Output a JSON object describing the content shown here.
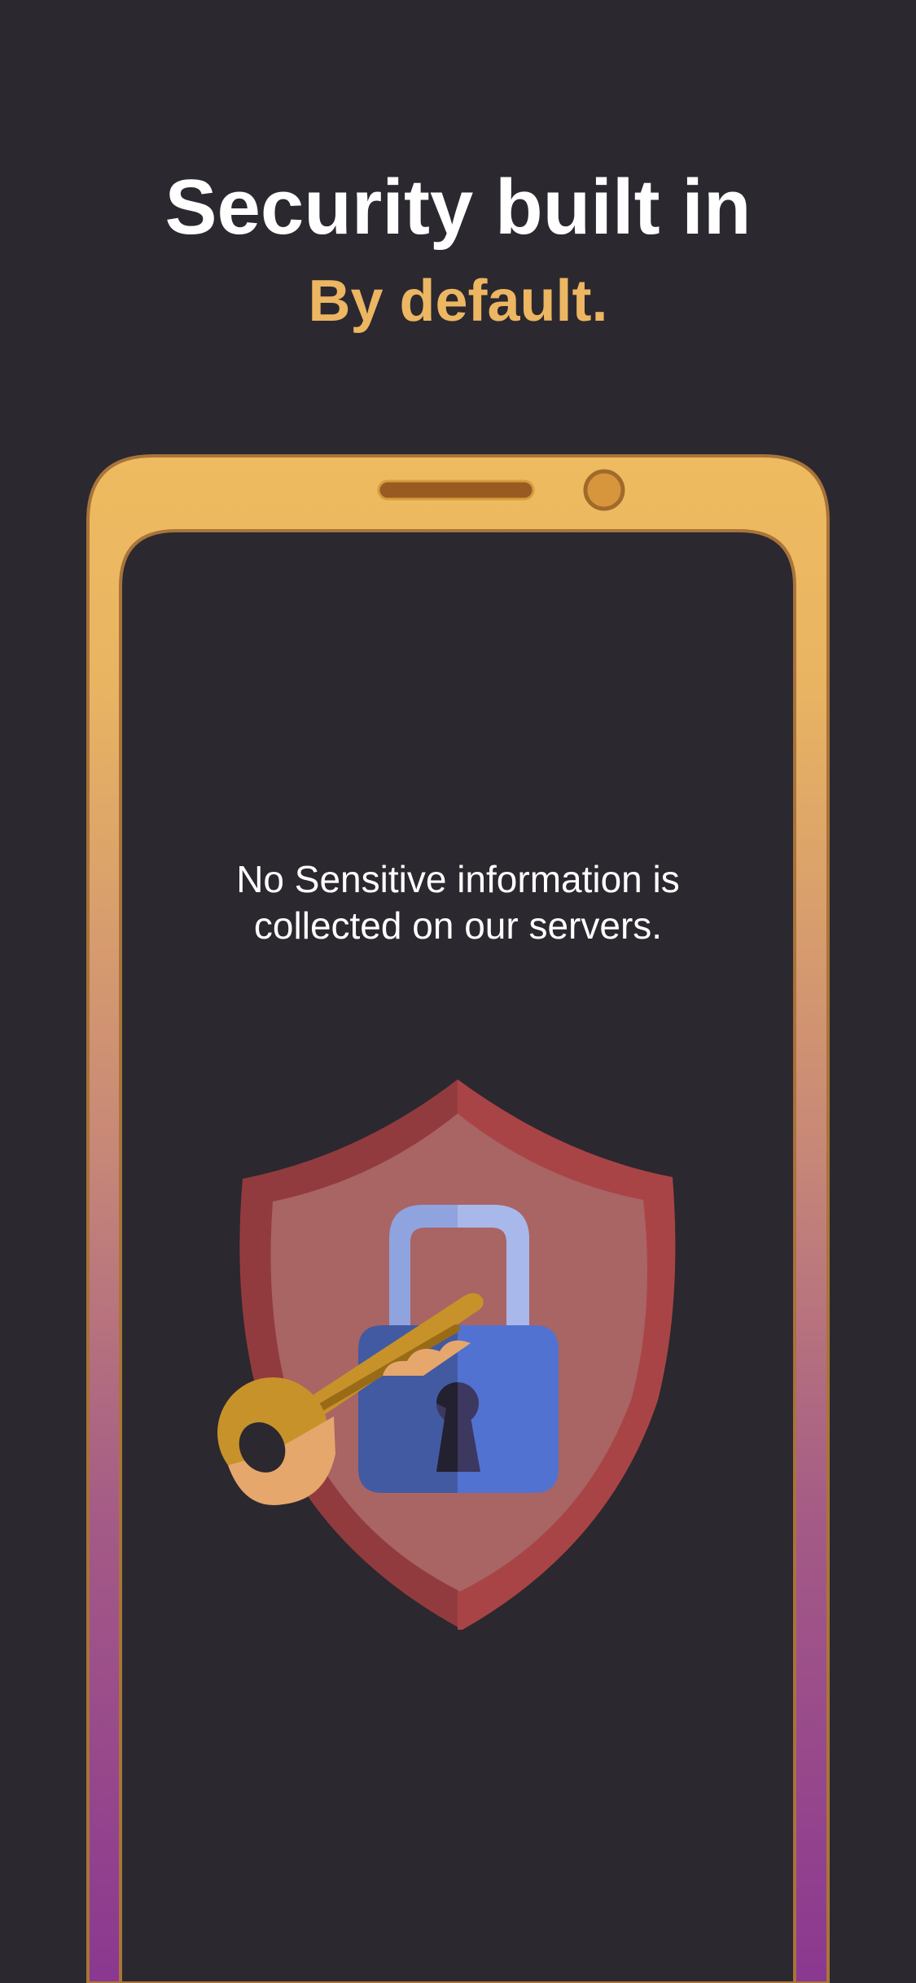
{
  "onboarding": {
    "title": "Security built in",
    "subtitle": "By default.",
    "message_line1": "No Sensitive information is",
    "message_line2": "collected on our servers."
  },
  "colors": {
    "background": "#2b282f",
    "accent": "#ecb662",
    "frame_top": "#eebb60",
    "frame_bottom": "#8e3b91",
    "shield": "#a94446",
    "lock": "#5272d2",
    "key": "#c7922a"
  },
  "icons": {
    "phone": "phone-frame-icon",
    "shield": "shield-icon",
    "padlock": "padlock-icon",
    "key": "key-icon"
  }
}
